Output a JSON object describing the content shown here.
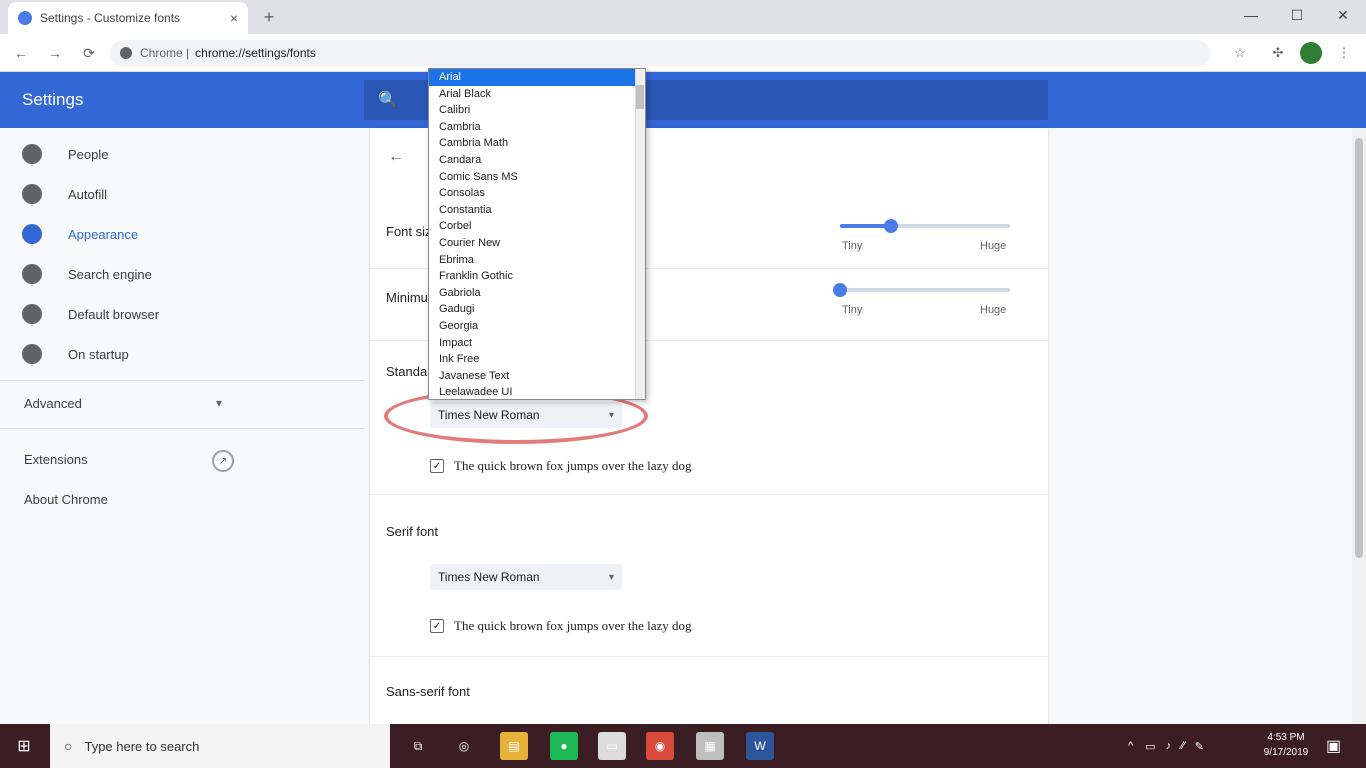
{
  "browser": {
    "tab_title": "Settings - Customize fonts",
    "tab_close": "×",
    "new_tab": "+",
    "window_controls": [
      "—",
      "☐",
      "✕"
    ],
    "nav": {
      "back": "←",
      "forward": "→",
      "reload": "⟳"
    },
    "omnibox": {
      "prefix": "Chrome |",
      "url": "chrome://settings/fonts"
    },
    "toolbar_icons": [
      "star-icon",
      "extension-icon",
      "menu-icon"
    ],
    "menu_glyph": "⋮"
  },
  "header": {
    "title": "Settings",
    "search_glyph": "🔍"
  },
  "sidebar": {
    "items": [
      {
        "label": "People",
        "icon": "person-icon"
      },
      {
        "label": "Autofill",
        "icon": "autofill-icon"
      },
      {
        "label": "Appearance",
        "icon": "appearance-icon",
        "active": true
      },
      {
        "label": "Search engine",
        "icon": "search-engine-icon"
      },
      {
        "label": "Default browser",
        "icon": "browser-icon"
      },
      {
        "label": "On startup",
        "icon": "power-icon"
      }
    ],
    "advanced": "Advanced",
    "advanced_chevron": "▾",
    "extensions": "Extensions",
    "about": "About Chrome"
  },
  "main": {
    "back_glyph": "←",
    "font_size_label": "Font size",
    "min_font_size_label": "Minimum font size",
    "slider1": {
      "min": "Tiny",
      "max": "Huge",
      "value": 0.3
    },
    "slider2": {
      "min": "Tiny",
      "max": "Huge",
      "value": 0.0
    },
    "standard_font_label": "Standard font",
    "standard_font_value": "Times New Roman",
    "serif_font_label": "Serif font",
    "serif_font_value": "Times New Roman",
    "sans_serif_font_label": "Sans-serif font",
    "sample_text": "The quick brown fox jumps over the lazy dog",
    "caret": "▾",
    "check": "✓"
  },
  "dropdown": {
    "options": [
      "Arial",
      "Arial Black",
      "Calibri",
      "Cambria",
      "Cambria Math",
      "Candara",
      "Comic Sans MS",
      "Consolas",
      "Constantia",
      "Corbel",
      "Courier New",
      "Ebrima",
      "Franklin Gothic",
      "Gabriola",
      "Gadugi",
      "Georgia",
      "Impact",
      "Ink Free",
      "Javanese Text",
      "Leelawadee UI"
    ],
    "selected_index": 0
  },
  "taskbar": {
    "start_glyph": "⊞",
    "search_placeholder": "Type here to search",
    "search_glyph": "○",
    "apps": [
      {
        "name": "task-view-icon",
        "glyph": "⧉",
        "color": "transparent"
      },
      {
        "name": "cortana-icon",
        "glyph": "◎",
        "color": "transparent"
      },
      {
        "name": "file-explorer-icon",
        "glyph": "▤",
        "color": "#e8b33a"
      },
      {
        "name": "spotify-icon",
        "glyph": "●",
        "color": "#1db954"
      },
      {
        "name": "notepad-icon",
        "glyph": "▭",
        "color": "#dcdcdc"
      },
      {
        "name": "chrome-icon",
        "glyph": "◉",
        "color": "#d94a3a"
      },
      {
        "name": "photos-icon",
        "glyph": "▦",
        "color": "#bfbfbf"
      },
      {
        "name": "word-icon",
        "glyph": "W",
        "color": "#2b579a"
      }
    ],
    "tray": [
      "^",
      "▭",
      "♪",
      "⁄⁄",
      "✎"
    ],
    "clock_time": "4:53 PM",
    "clock_date": "9/17/2019",
    "notification_glyph": "▣"
  },
  "colors": {
    "accent": "#3367d6",
    "highlight_ellipse": "#e27b7b"
  }
}
